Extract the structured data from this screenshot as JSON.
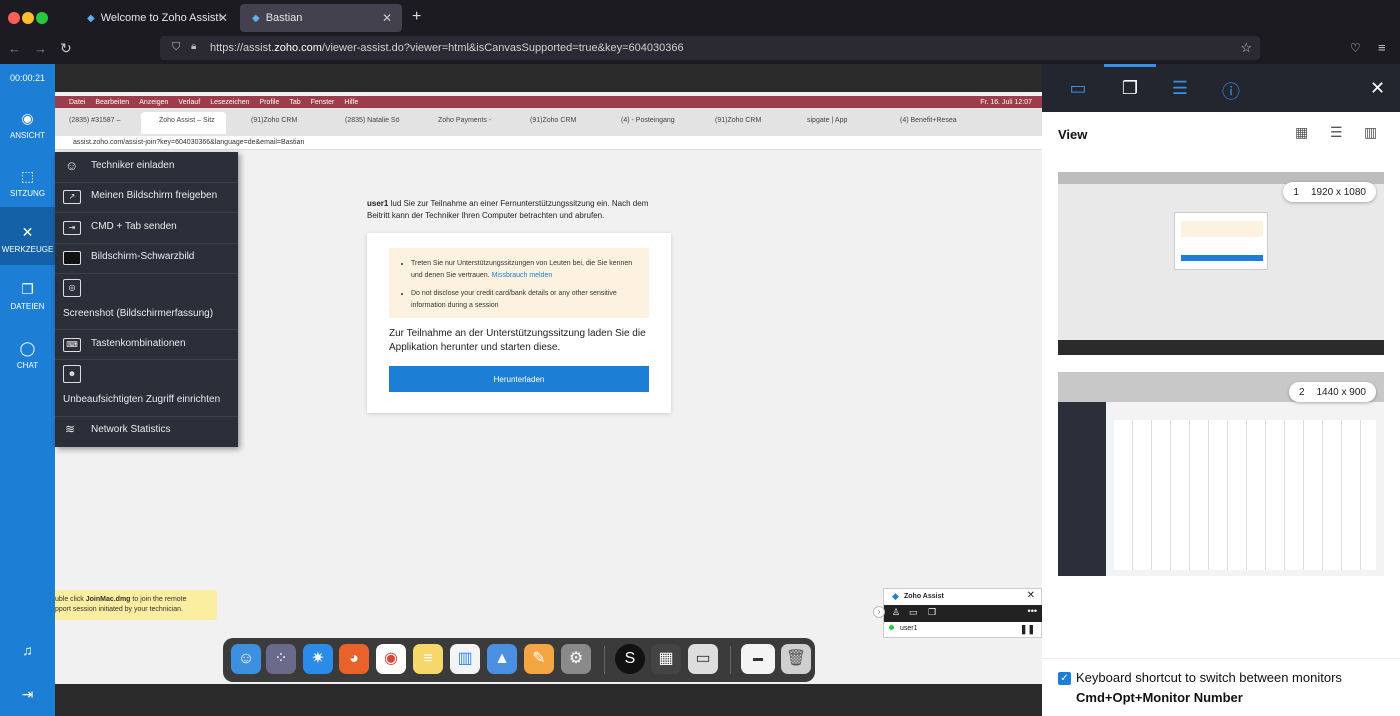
{
  "browser": {
    "tabs": [
      {
        "label": "Welcome to Zoho Assist!"
      },
      {
        "label": "Bastian"
      }
    ],
    "new_tab": "+",
    "url_host": "https://assist.",
    "url_domain": "zoho.com",
    "url_path": "/viewer-assist.do?viewer=html&isCanvasSupported=true&key=604030366"
  },
  "session": {
    "timer": "00:00:21"
  },
  "sidebar": {
    "items": [
      {
        "label": "ANSICHT",
        "icon": "eye-icon"
      },
      {
        "label": "SITZUNG",
        "icon": "cursor-icon"
      },
      {
        "label": "WERKZEUGE",
        "icon": "tools-icon"
      },
      {
        "label": "DATEIEN",
        "icon": "files-icon"
      },
      {
        "label": "CHAT",
        "icon": "chat-icon"
      }
    ]
  },
  "tools_menu": {
    "items": [
      {
        "label": "Techniker einladen",
        "icon": "invite-icon"
      },
      {
        "label": "Meinen Bildschirm freigeben",
        "icon": "share-screen-icon"
      },
      {
        "label": "CMD + Tab senden",
        "icon": "keyboard-tab-icon"
      },
      {
        "label": "Bildschirm-Schwarzbild",
        "icon": "monitor-icon"
      },
      {
        "label": "Screenshot (Bildschirmerfassung)",
        "icon": "camera-icon"
      },
      {
        "label": "Tastenkombinationen",
        "icon": "keyboard-icon"
      },
      {
        "label": "Unbeaufsichtigten Zugriff einrichten",
        "icon": "user-icon"
      },
      {
        "label": "Network Statistics",
        "icon": "wifi-icon"
      }
    ]
  },
  "remote": {
    "mac_menu": [
      "Datei",
      "Bearbeiten",
      "Anzeigen",
      "Verlauf",
      "Lesezeichen",
      "Profile",
      "Tab",
      "Fenster",
      "Hilfe"
    ],
    "mac_clock": "Fr. 16. Juli  12:07",
    "inner_tabs": [
      "(2835) #31587 – ",
      "Zoho Assist – Sitz",
      "(91)Zoho CRM",
      "(2835) Natalie Sö",
      "Zoho Payments - ",
      "(91)Zoho CRM",
      "(4) - Posteingang",
      "(91)Zoho CRM",
      "sipgate | App",
      "(4) Benefit+Resea"
    ],
    "inner_url": "assist.zoho.com/assist-join?key=604030366&language=de&email=Bastian",
    "invite_user": "user1",
    "invite_text": "lud Sie zur Teilnahme an einer Fernunterstützungssitzung ein. Nach dem Beitritt kann der Techniker Ihren Computer betrachten und abrufen.",
    "warn1": "Treten Sie nur Unterstützungssitzungen von Leuten bei, die Sie kennen und denen Sie vertrauen.",
    "warn1_link": "Missbrauch melden",
    "warn2": "Do not disclose your credit card/bank details or any other sensitive information during a session",
    "card_text": "Zur Teilnahme an der Unterstützungssitzung laden Sie die Applikation herunter und starten diese.",
    "download_label": "Herunterladen",
    "notif_prefix": "uble click ",
    "notif_file": "JoinMac.dmg",
    "notif_rest": " to join the remote",
    "notif_line2": "pport session initiated by your technician.",
    "mini_title": "Zoho Assist",
    "mini_user": "user1"
  },
  "panel": {
    "view_title": "View",
    "monitors": [
      {
        "number": "1",
        "resolution": "1920 x 1080"
      },
      {
        "number": "2",
        "resolution": "1440 x 900"
      }
    ],
    "kb_text": "Keyboard shortcut to switch between monitors",
    "kb_combo": "Cmd+Opt+Monitor Number"
  },
  "colors": {
    "accent": "#1d7ed6",
    "dark": "#24262f"
  }
}
